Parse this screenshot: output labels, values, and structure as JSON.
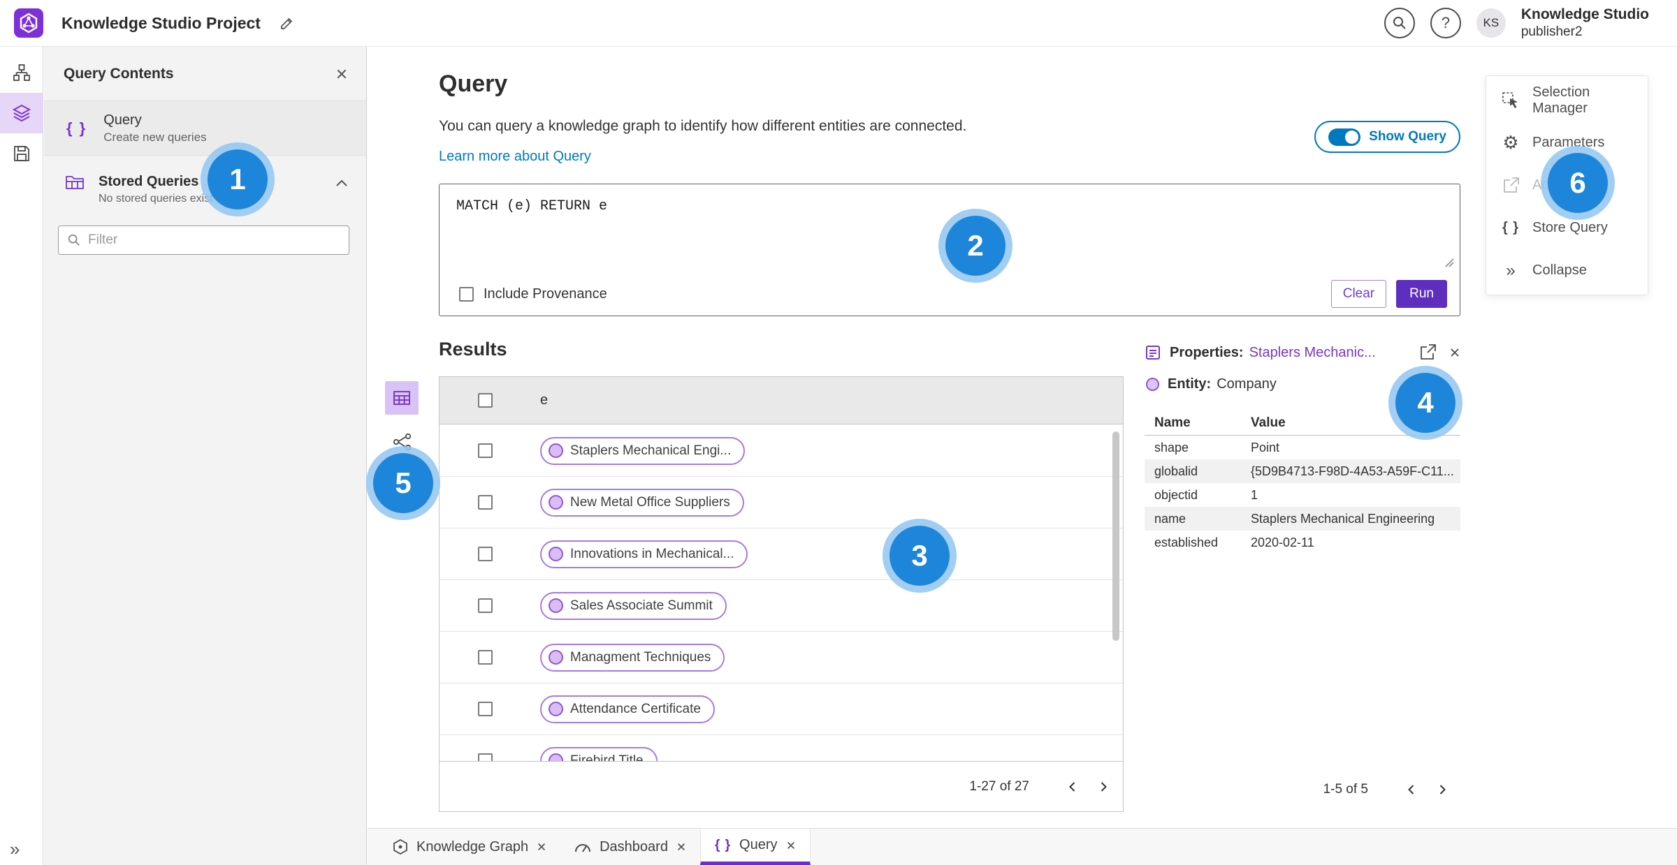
{
  "app": {
    "title": "Knowledge Studio Project",
    "user": {
      "name": "Knowledge Studio",
      "role": "publisher2",
      "initials": "KS"
    }
  },
  "left_panel": {
    "title": "Query Contents",
    "query_item": {
      "label": "Query",
      "sublabel": "Create new queries"
    },
    "stored_queries": {
      "label": "Stored Queries",
      "sublabel": "No stored queries exist"
    },
    "filter_placeholder": "Filter"
  },
  "query_section": {
    "title": "Query",
    "description": "You can query a knowledge graph to identify how different entities are connected.",
    "learn_more": "Learn more about Query",
    "show_query": "Show Query",
    "query_text": "MATCH (e) RETURN e",
    "include_provenance": "Include Provenance",
    "clear": "Clear",
    "run": "Run"
  },
  "results": {
    "title": "Results",
    "column": "e",
    "rows": [
      "Staplers Mechanical Engi...",
      "New Metal Office Suppliers",
      "Innovations in Mechanical...",
      "Sales Associate Summit",
      "Managment Techniques",
      "Attendance Certificate",
      "Firebird Title"
    ],
    "pagination": "1-27 of 27"
  },
  "properties": {
    "label": "Properties:",
    "entity_link": "Staplers Mechanic...",
    "entity_label": "Entity:",
    "entity_type": "Company",
    "col_name": "Name",
    "col_value": "Value",
    "rows": [
      {
        "name": "shape",
        "value": "Point"
      },
      {
        "name": "globalid",
        "value": "{5D9B4713-F98D-4A53-A59F-C11..."
      },
      {
        "name": "objectid",
        "value": "1"
      },
      {
        "name": "name",
        "value": "Staplers Mechanical Engineering"
      },
      {
        "name": "established",
        "value": "2020-02-11"
      }
    ],
    "pagination": "1-5 of 5"
  },
  "side_menu": {
    "items": [
      {
        "label": "Selection Manager"
      },
      {
        "label": "Parameters"
      },
      {
        "label": "Add To Map"
      },
      {
        "label": "Store Query"
      },
      {
        "label": "Collapse"
      }
    ]
  },
  "tabs": [
    {
      "label": "Knowledge Graph"
    },
    {
      "label": "Dashboard"
    },
    {
      "label": "Query"
    }
  ],
  "annotations": [
    "1",
    "2",
    "3",
    "4",
    "5",
    "6"
  ],
  "colors": {
    "accent_purple": "#7a35cc",
    "run_purple": "#5e2ebe",
    "link_blue": "#0079c1",
    "badge_blue": "#1d86da"
  }
}
